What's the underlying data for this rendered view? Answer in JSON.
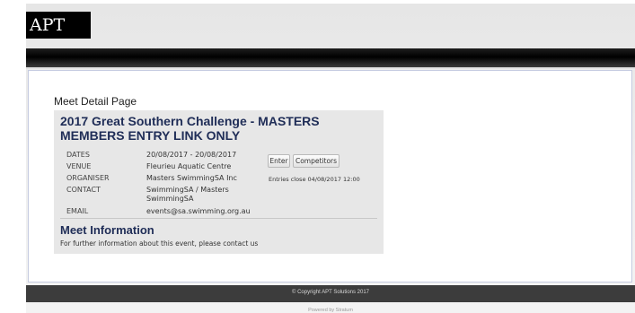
{
  "header": {
    "logo_text": "APT"
  },
  "page": {
    "title": "Meet Detail Page"
  },
  "meet": {
    "name": "2017 Great Southern Challenge - MASTERS MEMBERS ENTRY LINK ONLY",
    "details": [
      {
        "label": "DATES",
        "value": "20/08/2017 - 20/08/2017"
      },
      {
        "label": "VENUE",
        "value": "Fleurieu Aquatic Centre"
      },
      {
        "label": "ORGANISER",
        "value": "Masters SwimmingSA Inc"
      },
      {
        "label": "CONTACT",
        "value": "SwimmingSA / Masters SwimmingSA"
      },
      {
        "label": "EMAIL",
        "value": "events@sa.swimming.org.au"
      }
    ],
    "enter_button": "Enter",
    "competitors_button": "Competitors",
    "entries_close": "Entries close 04/08/2017 12:00"
  },
  "info": {
    "heading": "Meet Information",
    "text": "For further information about this event, please contact us"
  },
  "footer": {
    "copyright": "© Copyright APT Solutions 2017",
    "powered_by": "Powered by Stratum"
  },
  "colors": {
    "heading": "#1f2d57",
    "navbar": "#000000",
    "footer": "#3c3c3c",
    "meet_box": "#e7e7e7"
  }
}
